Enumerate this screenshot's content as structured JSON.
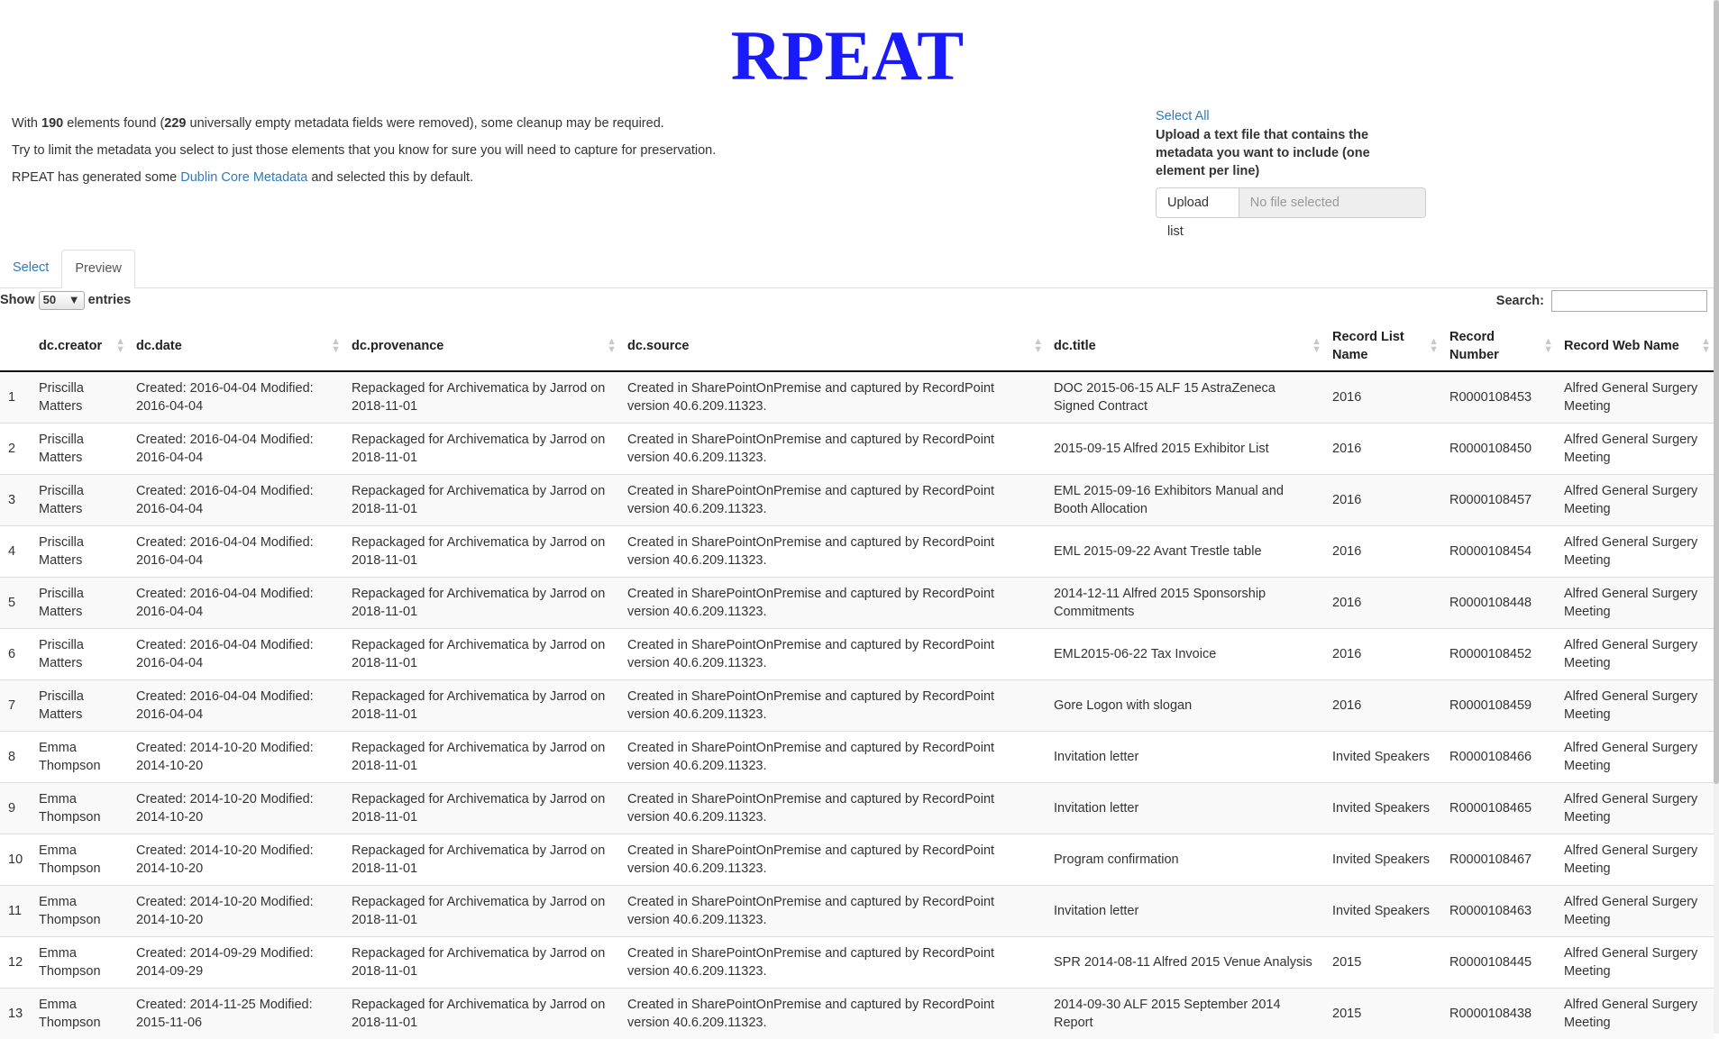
{
  "app": {
    "title": "RPEAT"
  },
  "intro": {
    "line1_prefix": "With ",
    "elements_found": "190",
    "line1_mid": " elements found (",
    "empty_removed": "229",
    "line1_suffix": " universally empty metadata fields were removed), some cleanup may be required.",
    "line2": "Try to limit the metadata you select to just those elements that you know for sure you will need to capture for preservation.",
    "line3_prefix": "RPEAT has generated some ",
    "line3_link": "Dublin Core Metadata",
    "line3_suffix": " and selected this by default."
  },
  "upload": {
    "select_all": "Select All",
    "label": "Upload a text file that contains the metadata you want to include (one element per line)",
    "button": "Upload list",
    "file_placeholder": "No file selected"
  },
  "tabs": [
    {
      "label": "Select",
      "active": false
    },
    {
      "label": "Preview",
      "active": true
    }
  ],
  "table_controls": {
    "show_label": "Show",
    "length_value": "50",
    "entries_label": "entries",
    "search_label": "Search:",
    "search_value": ""
  },
  "columns": [
    "",
    "dc.creator",
    "dc.date",
    "dc.provenance",
    "dc.source",
    "dc.title",
    "Record List Name",
    "Record Number",
    "Record Web Name"
  ],
  "rows": [
    [
      "1",
      "Priscilla Matters",
      "Created: 2016-04-04 Modified: 2016-04-04",
      "Repackaged for Archivematica by Jarrod on 2018-11-01",
      "Created in SharePointOnPremise and captured by RecordPoint version 40.6.209.11323.",
      "DOC 2015-06-15 ALF 15 AstraZeneca Signed Contract",
      "2016",
      "R0000108453",
      "Alfred General Surgery Meeting"
    ],
    [
      "2",
      "Priscilla Matters",
      "Created: 2016-04-04 Modified: 2016-04-04",
      "Repackaged for Archivematica by Jarrod on 2018-11-01",
      "Created in SharePointOnPremise and captured by RecordPoint version 40.6.209.11323.",
      "2015-09-15 Alfred 2015 Exhibitor List",
      "2016",
      "R0000108450",
      "Alfred General Surgery Meeting"
    ],
    [
      "3",
      "Priscilla Matters",
      "Created: 2016-04-04 Modified: 2016-04-04",
      "Repackaged for Archivematica by Jarrod on 2018-11-01",
      "Created in SharePointOnPremise and captured by RecordPoint version 40.6.209.11323.",
      "EML 2015-09-16 Exhibitors Manual and Booth Allocation",
      "2016",
      "R0000108457",
      "Alfred General Surgery Meeting"
    ],
    [
      "4",
      "Priscilla Matters",
      "Created: 2016-04-04 Modified: 2016-04-04",
      "Repackaged for Archivematica by Jarrod on 2018-11-01",
      "Created in SharePointOnPremise and captured by RecordPoint version 40.6.209.11323.",
      "EML 2015-09-22 Avant Trestle table",
      "2016",
      "R0000108454",
      "Alfred General Surgery Meeting"
    ],
    [
      "5",
      "Priscilla Matters",
      "Created: 2016-04-04 Modified: 2016-04-04",
      "Repackaged for Archivematica by Jarrod on 2018-11-01",
      "Created in SharePointOnPremise and captured by RecordPoint version 40.6.209.11323.",
      "2014-12-11 Alfred 2015 Sponsorship Commitments",
      "2016",
      "R0000108448",
      "Alfred General Surgery Meeting"
    ],
    [
      "6",
      "Priscilla Matters",
      "Created: 2016-04-04 Modified: 2016-04-04",
      "Repackaged for Archivematica by Jarrod on 2018-11-01",
      "Created in SharePointOnPremise and captured by RecordPoint version 40.6.209.11323.",
      "EML2015-06-22 Tax Invoice",
      "2016",
      "R0000108452",
      "Alfred General Surgery Meeting"
    ],
    [
      "7",
      "Priscilla Matters",
      "Created: 2016-04-04 Modified: 2016-04-04",
      "Repackaged for Archivematica by Jarrod on 2018-11-01",
      "Created in SharePointOnPremise and captured by RecordPoint version 40.6.209.11323.",
      "Gore Logon with slogan",
      "2016",
      "R0000108459",
      "Alfred General Surgery Meeting"
    ],
    [
      "8",
      "Emma Thompson",
      "Created: 2014-10-20 Modified: 2014-10-20",
      "Repackaged for Archivematica by Jarrod on 2018-11-01",
      "Created in SharePointOnPremise and captured by RecordPoint version 40.6.209.11323.",
      "Invitation letter",
      "Invited Speakers",
      "R0000108466",
      "Alfred General Surgery Meeting"
    ],
    [
      "9",
      "Emma Thompson",
      "Created: 2014-10-20 Modified: 2014-10-20",
      "Repackaged for Archivematica by Jarrod on 2018-11-01",
      "Created in SharePointOnPremise and captured by RecordPoint version 40.6.209.11323.",
      "Invitation letter",
      "Invited Speakers",
      "R0000108465",
      "Alfred General Surgery Meeting"
    ],
    [
      "10",
      "Emma Thompson",
      "Created: 2014-10-20 Modified: 2014-10-20",
      "Repackaged for Archivematica by Jarrod on 2018-11-01",
      "Created in SharePointOnPremise and captured by RecordPoint version 40.6.209.11323.",
      "Program confirmation",
      "Invited Speakers",
      "R0000108467",
      "Alfred General Surgery Meeting"
    ],
    [
      "11",
      "Emma Thompson",
      "Created: 2014-10-20 Modified: 2014-10-20",
      "Repackaged for Archivematica by Jarrod on 2018-11-01",
      "Created in SharePointOnPremise and captured by RecordPoint version 40.6.209.11323.",
      "Invitation letter",
      "Invited Speakers",
      "R0000108463",
      "Alfred General Surgery Meeting"
    ],
    [
      "12",
      "Emma Thompson",
      "Created: 2014-09-29 Modified: 2014-09-29",
      "Repackaged for Archivematica by Jarrod on 2018-11-01",
      "Created in SharePointOnPremise and captured by RecordPoint version 40.6.209.11323.",
      "SPR 2014-08-11 Alfred 2015 Venue Analysis",
      "2015",
      "R0000108445",
      "Alfred General Surgery Meeting"
    ],
    [
      "13",
      "Emma Thompson",
      "Created: 2014-11-25 Modified: 2015-11-06",
      "Repackaged for Archivematica by Jarrod on 2018-11-01",
      "Created in SharePointOnPremise and captured by RecordPoint version 40.6.209.11323.",
      "2014-09-30 ALF 2015 September 2014 Report",
      "2015",
      "R0000108438",
      "Alfred General Surgery Meeting"
    ]
  ],
  "colors": {
    "title": "#1a1aff",
    "link": "#337ab7",
    "stripe": "#f9f9f9"
  }
}
